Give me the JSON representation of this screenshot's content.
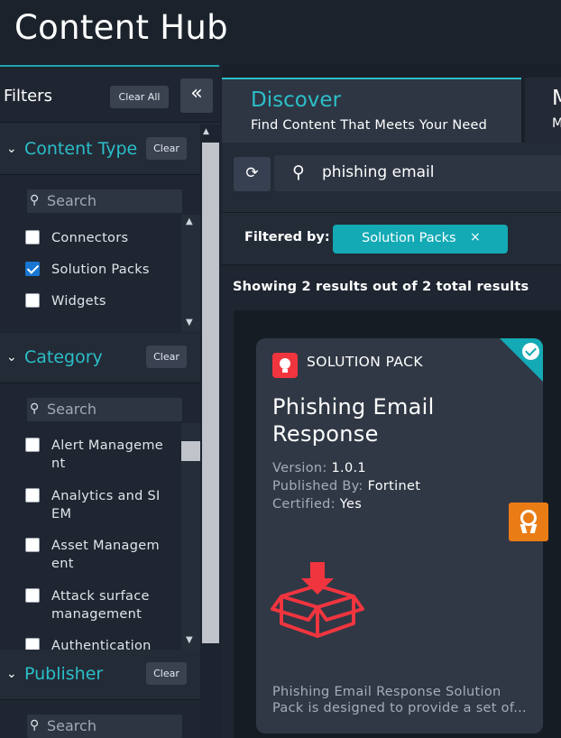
{
  "app": {
    "title": "Content Hub"
  },
  "sidebar": {
    "filters_title": "Filters",
    "clear_all_label": "Clear All",
    "collapse_icon": "«",
    "sections": [
      {
        "title": "Content Type",
        "clear_label": "Clear",
        "search_placeholder": "Search",
        "options": [
          {
            "label": "Connectors",
            "checked": false
          },
          {
            "label": "Solution Packs",
            "checked": true
          },
          {
            "label": "Widgets",
            "checked": false
          }
        ]
      },
      {
        "title": "Category",
        "clear_label": "Clear",
        "search_placeholder": "Search",
        "options": [
          {
            "label": "Alert Manageme nt",
            "checked": false
          },
          {
            "label": "Analytics and SI EM",
            "checked": false
          },
          {
            "label": "Asset Managem ent",
            "checked": false
          },
          {
            "label": "Attack surface management",
            "checked": false
          },
          {
            "label": "Authentication",
            "checked": false
          }
        ]
      },
      {
        "title": "Publisher",
        "clear_label": "Clear",
        "search_placeholder": "Search",
        "options": []
      }
    ]
  },
  "main": {
    "tabs": [
      {
        "label": "Discover",
        "sublabel": "Find Content That Meets Your Need",
        "active": true
      },
      {
        "label": "M",
        "sublabel": "M",
        "active": false
      }
    ],
    "search": {
      "value": "phishing email",
      "refresh_icon": "refresh-icon"
    },
    "filtered_by_label": "Filtered by:",
    "active_filter": {
      "label": "Solution Packs",
      "remove_icon": "×"
    },
    "results_text": "Showing 2 results out of 2 total results",
    "cards": [
      {
        "type_label": "SOLUTION PACK",
        "name": "Phishing Email Response",
        "version_label": "Version:",
        "version": "1.0.1",
        "published_label": "Published By:",
        "publisher": "Fortinet",
        "certified_label": "Certified:",
        "certified": "Yes",
        "installed": true,
        "description": "Phishing Email Response Solution Pack is designed to provide a set of..."
      }
    ]
  },
  "colors": {
    "accent": "#2bbfc9",
    "chip": "#13aab5",
    "brand_red": "#f0353f",
    "award_orange": "#ea7c15",
    "checkbox_blue": "#1976d2"
  }
}
